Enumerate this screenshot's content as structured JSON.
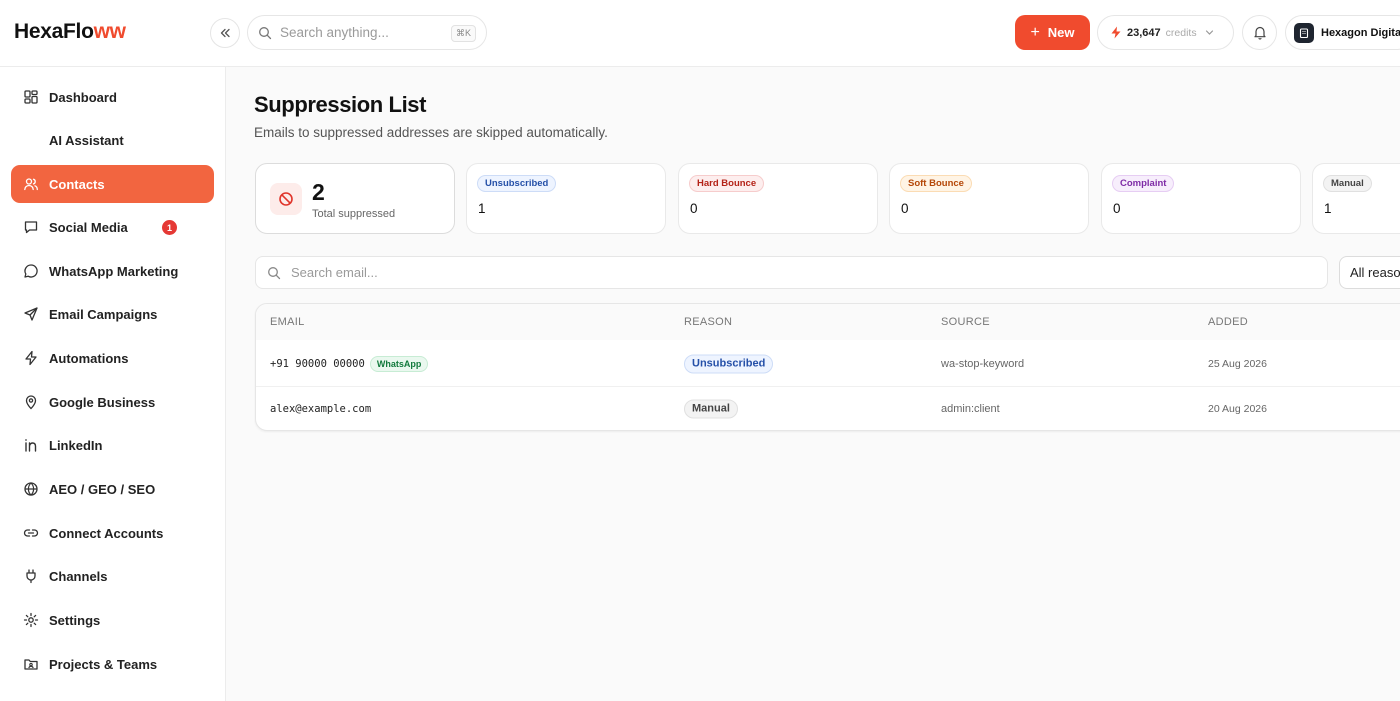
{
  "brand": {
    "name_main": "HexaFlo",
    "name_accent": "ww",
    "accent": "#f04b2e"
  },
  "topbar": {
    "search_placeholder": "Search anything...",
    "search_shortcut": "⌘K",
    "new_label": "New",
    "credits_value": "23,647",
    "credits_label": "credits",
    "workspace_name": "Hexagon Digital"
  },
  "sidebar": {
    "items": [
      {
        "label": "Dashboard",
        "icon": "dashboard-icon"
      },
      {
        "label": "AI Assistant",
        "icon": "ai-assistant-icon"
      },
      {
        "label": "Contacts",
        "icon": "contacts-icon",
        "active": true
      },
      {
        "label": "Social Media",
        "icon": "social-media-icon",
        "badge": "1"
      },
      {
        "label": "WhatsApp Marketing",
        "icon": "whatsapp-icon"
      },
      {
        "label": "Email Campaigns",
        "icon": "send-icon"
      },
      {
        "label": "Automations",
        "icon": "lightning-icon"
      },
      {
        "label": "Google Business",
        "icon": "map-pin-icon"
      },
      {
        "label": "LinkedIn",
        "icon": "linkedin-icon"
      },
      {
        "label": "AEO / GEO / SEO",
        "icon": "globe-icon"
      },
      {
        "label": "Connect Accounts",
        "icon": "link-icon"
      },
      {
        "label": "Channels",
        "icon": "plug-icon"
      },
      {
        "label": "Settings",
        "icon": "gear-icon"
      },
      {
        "label": "Projects & Teams",
        "icon": "folder-users-icon"
      }
    ]
  },
  "page": {
    "title": "Suppression List",
    "subtitle": "Emails to suppressed addresses are skipped automatically."
  },
  "stats": {
    "total_value": "2",
    "total_label": "Total suppressed",
    "cards": [
      {
        "label": "Unsubscribed",
        "value": "1"
      },
      {
        "label": "Hard Bounce",
        "value": "0"
      },
      {
        "label": "Soft Bounce",
        "value": "0"
      },
      {
        "label": "Complaint",
        "value": "0"
      },
      {
        "label": "Manual",
        "value": "1"
      }
    ]
  },
  "filters": {
    "search_placeholder": "Search email...",
    "reason_selected": "All reasons"
  },
  "table": {
    "headers": {
      "email": "EMAIL",
      "reason": "REASON",
      "source": "SOURCE",
      "added": "ADDED"
    },
    "rows": [
      {
        "email": "+91 90000 00000",
        "channel_tag": "WhatsApp",
        "reason": "Unsubscribed",
        "source": "wa-stop-keyword",
        "added": "25 Aug 2026"
      },
      {
        "email": "alex@example.com",
        "reason": "Manual",
        "source": "admin:client",
        "added": "20 Aug 2026"
      }
    ]
  }
}
